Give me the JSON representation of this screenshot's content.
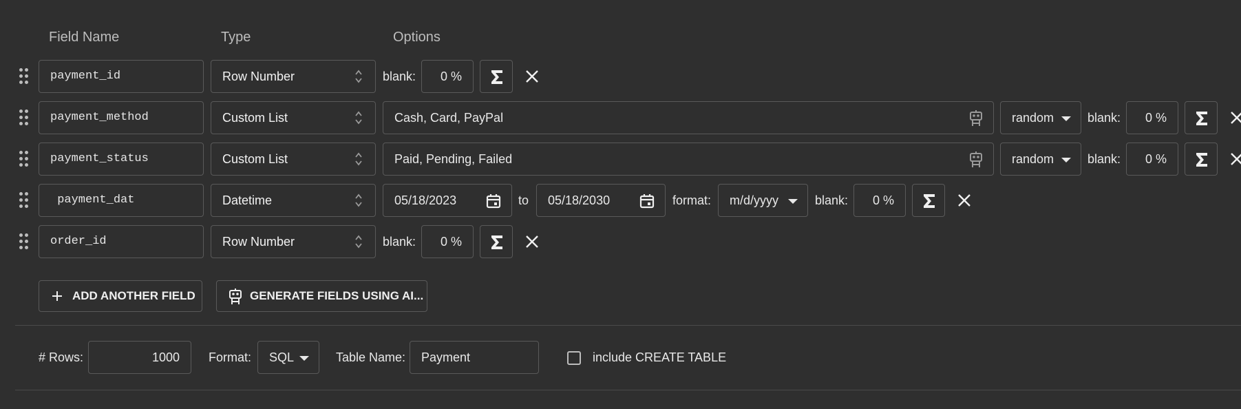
{
  "headers": {
    "field_name": "Field Name",
    "type": "Type",
    "options": "Options"
  },
  "fields": [
    {
      "name": "payment_id",
      "type": "Row Number",
      "blank_label": "blank:",
      "blank_value": "0 %"
    },
    {
      "name": "payment_method",
      "type": "Custom List",
      "values": "Cash, Card, PayPal",
      "order": "random",
      "blank_label": "blank:",
      "blank_value": "0 %"
    },
    {
      "name": "payment_status",
      "type": "Custom List",
      "values": "Paid, Pending, Failed",
      "order": "random",
      "blank_label": "blank:",
      "blank_value": "0 %"
    },
    {
      "name": " payment_dat",
      "type": "Datetime",
      "from": "05/18/2023",
      "to_label": "to",
      "to": "05/18/2030",
      "format_label": "format:",
      "format": "m/d/yyyy",
      "blank_label": "blank:",
      "blank_value": "0 %"
    },
    {
      "name": "order_id",
      "type": "Row Number",
      "blank_label": "blank:",
      "blank_value": "0 %"
    }
  ],
  "actions": {
    "add_field": "ADD ANOTHER FIELD",
    "generate_ai": "GENERATE FIELDS USING AI..."
  },
  "settings": {
    "rows_label": "# Rows:",
    "rows_value": "1000",
    "format_label": "Format:",
    "format_value": "SQL",
    "table_name_label": "Table Name:",
    "table_name_value": "Payment",
    "create_table_label": "include CREATE TABLE",
    "create_table_checked": false
  },
  "icons": {
    "drag": "drag-handle-icon",
    "sigma": "sigma-icon",
    "close": "close-icon",
    "robot": "robot-icon",
    "calendar": "calendar-icon",
    "plus": "plus-icon",
    "updown": "up-down-chevron-icon"
  }
}
